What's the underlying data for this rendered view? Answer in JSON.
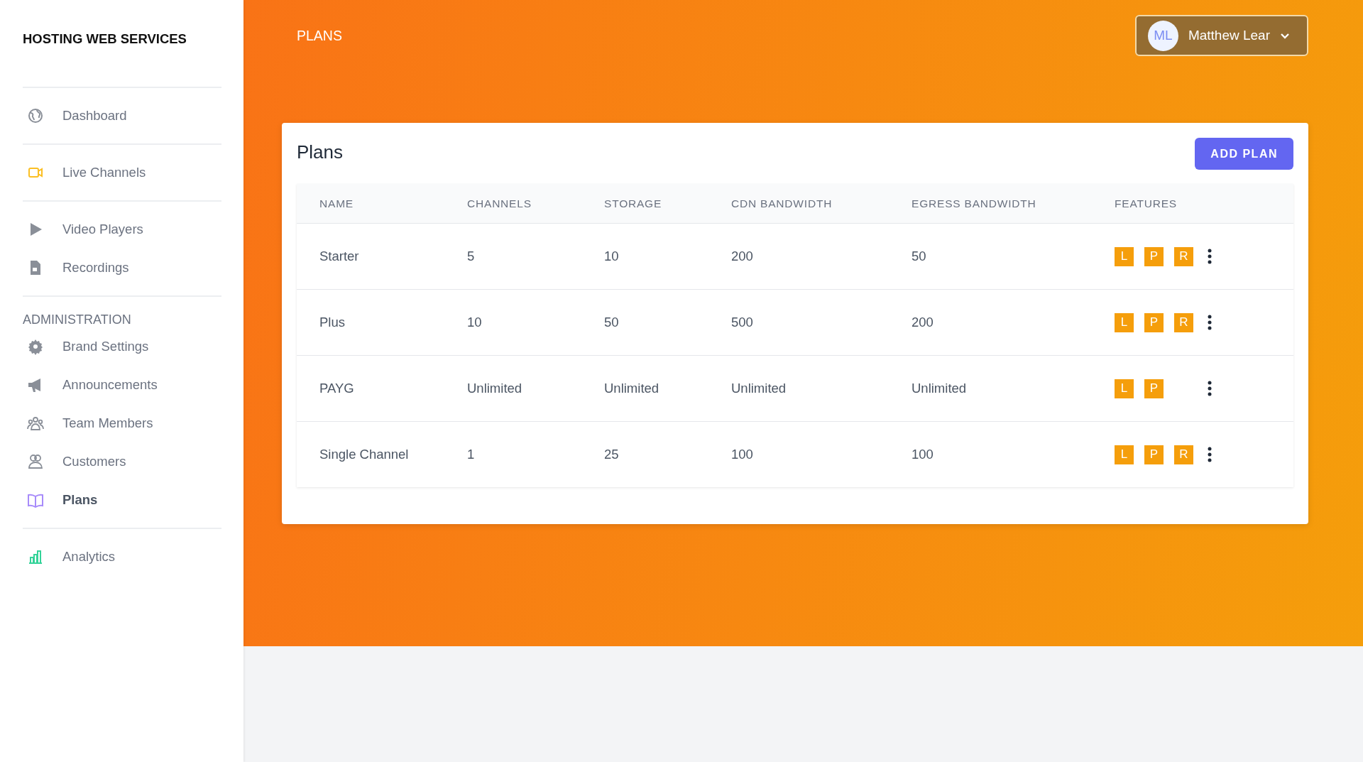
{
  "sidebar": {
    "brand": "HOSTING WEB SERVICES",
    "groups": [
      {
        "items": [
          {
            "label": "Dashboard",
            "kind": "globe",
            "color": "#8a8f98",
            "selected": false
          }
        ]
      },
      {
        "items": [
          {
            "label": "Live Channels",
            "kind": "video",
            "color": "#fbbf24",
            "selected": false
          }
        ]
      },
      {
        "items": [
          {
            "label": "Video Players",
            "kind": "play",
            "color": "#8a8f98",
            "selected": false
          },
          {
            "label": "Recordings",
            "kind": "file",
            "color": "#8a8f98",
            "selected": false
          }
        ]
      },
      {
        "heading": "ADMINISTRATION",
        "items": [
          {
            "label": "Brand Settings",
            "kind": "gear",
            "color": "#8a8f98",
            "selected": false
          },
          {
            "label": "Announcements",
            "kind": "megaphone",
            "color": "#8a8f98",
            "selected": false
          },
          {
            "label": "Team Members",
            "kind": "team",
            "color": "#8a8f98",
            "selected": false
          },
          {
            "label": "Customers",
            "kind": "users",
            "color": "#8a8f98",
            "selected": false
          },
          {
            "label": "Plans",
            "kind": "book",
            "color": "#a78bfa",
            "selected": true
          }
        ]
      },
      {
        "items": [
          {
            "label": "Analytics",
            "kind": "chart",
            "color": "#34d399",
            "selected": false
          }
        ]
      }
    ]
  },
  "header": {
    "title": "PLANS",
    "user": {
      "initials": "ML",
      "name": "Matthew Lear"
    }
  },
  "card": {
    "title": "Plans",
    "add_button": "ADD PLAN",
    "table": {
      "columns": [
        "NAME",
        "CHANNELS",
        "STORAGE",
        "CDN BANDWIDTH",
        "EGRESS BANDWIDTH",
        "FEATURES"
      ],
      "rows": [
        {
          "cells": [
            "Starter",
            "5",
            "10",
            "200",
            "50"
          ],
          "features": [
            "L",
            "P",
            "R"
          ]
        },
        {
          "cells": [
            "Plus",
            "10",
            "50",
            "500",
            "200"
          ],
          "features": [
            "L",
            "P",
            "R"
          ]
        },
        {
          "cells": [
            "PAYG",
            "Unlimited",
            "Unlimited",
            "Unlimited",
            "Unlimited"
          ],
          "features": [
            "L",
            "P"
          ]
        },
        {
          "cells": [
            "Single Channel",
            "1",
            "25",
            "100",
            "100"
          ],
          "features": [
            "L",
            "P",
            "R"
          ]
        }
      ]
    }
  }
}
